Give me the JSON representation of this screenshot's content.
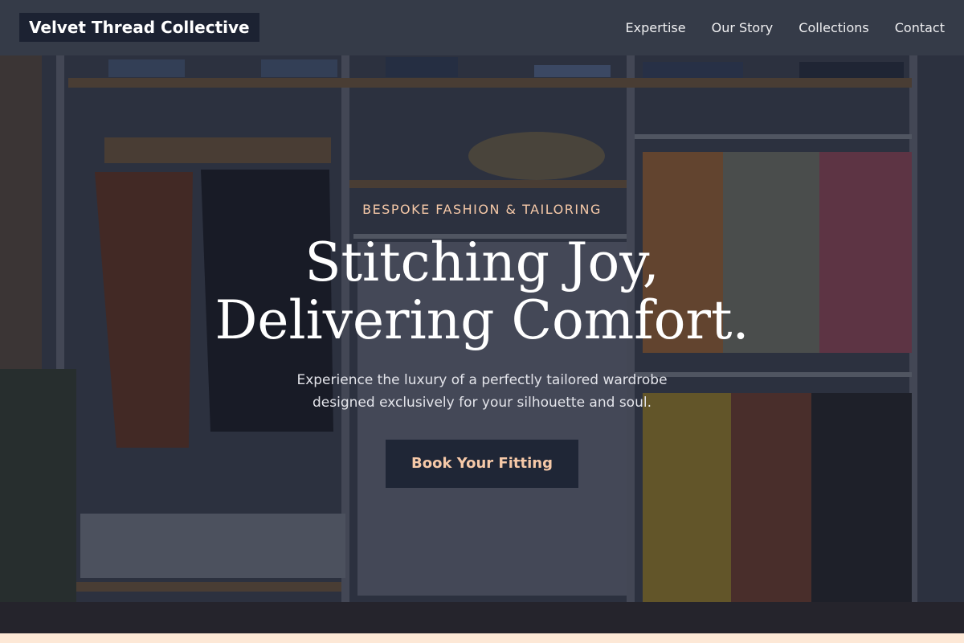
{
  "header": {
    "brand": "Velvet Thread Collective",
    "nav": [
      "Expertise",
      "Our Story",
      "Collections",
      "Contact"
    ]
  },
  "hero": {
    "eyebrow": "BESPOKE FASHION & TAILORING",
    "headline_line1": "Stitching Joy,",
    "headline_line2": "Delivering Comfort.",
    "subtext": "Experience the luxury of a perfectly tailored wardrobe designed exclusively for your silhouette and soul.",
    "cta_label": "Book Your Fitting"
  },
  "colors": {
    "header_bg": "#353b48",
    "brand_bg": "#1c2232",
    "accent": "#f6c9a8",
    "cta_bg": "#1f2636",
    "bottom_strip": "#fde8d6"
  }
}
